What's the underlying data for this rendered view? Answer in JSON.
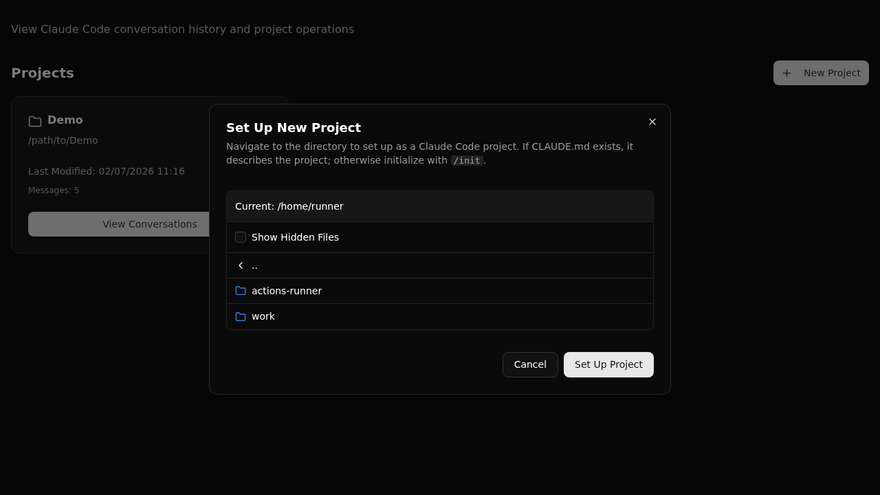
{
  "page": {
    "subtitle": "View Claude Code conversation history and project operations",
    "section_title": "Projects",
    "new_project_button": {
      "icon": "+",
      "label": "New Project"
    }
  },
  "projects": [
    {
      "name": "Demo",
      "path": "/path/to/Demo",
      "last_modified": "Last Modified: 02/07/2026 11:16",
      "messages": "Messages: 5",
      "button": "View Conversations"
    }
  ],
  "dialog": {
    "title": "Set Up New Project",
    "description": [
      {
        "kind": "text",
        "text": "Navigate to the directory to set up as a Claude Code project. If CLAUDE.md exists, it describes the project; otherwise initialize with "
      },
      {
        "kind": "code",
        "text": "/init"
      },
      {
        "kind": "text",
        "text": "."
      }
    ],
    "current_path": "Current: /home/runner",
    "show_hidden": {
      "label": "Show Hidden Files",
      "checked": false
    },
    "entries": [
      {
        "kind": "parent",
        "name": ".."
      },
      {
        "kind": "folder",
        "name": "actions-runner"
      },
      {
        "kind": "folder",
        "name": "work"
      }
    ],
    "buttons": [
      {
        "kind": "secondary",
        "label": "Cancel"
      },
      {
        "kind": "primary",
        "label": "Set Up Project"
      }
    ]
  }
}
